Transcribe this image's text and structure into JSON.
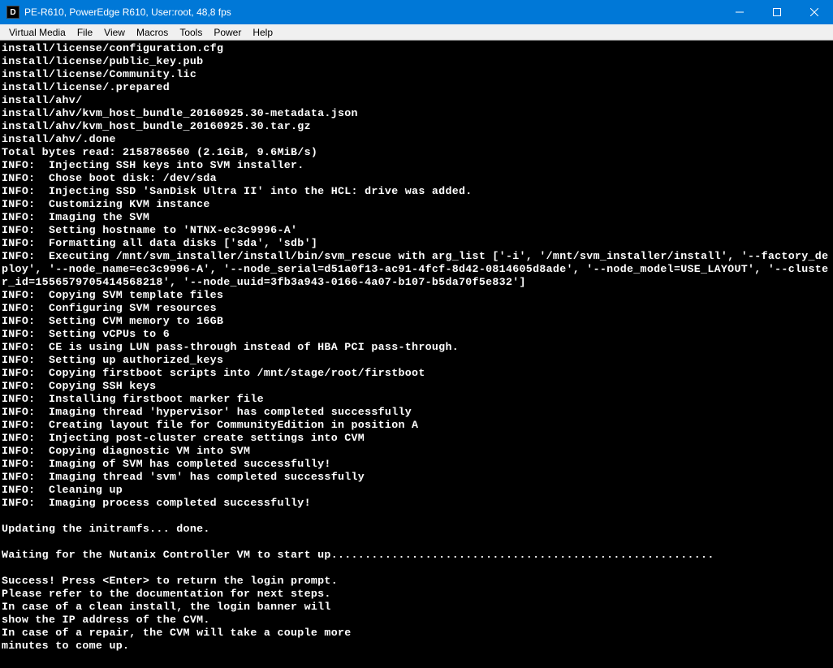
{
  "titlebar": {
    "icon_letter": "D",
    "title": "PE-R610, PowerEdge R610, User:root, 48,8 fps"
  },
  "menu": {
    "items": [
      "Virtual Media",
      "File",
      "View",
      "Macros",
      "Tools",
      "Power",
      "Help"
    ]
  },
  "terminal": {
    "lines": [
      "install/license/configuration.cfg",
      "install/license/public_key.pub",
      "install/license/Community.lic",
      "install/license/.prepared",
      "install/ahv/",
      "install/ahv/kvm_host_bundle_20160925.30-metadata.json",
      "install/ahv/kvm_host_bundle_20160925.30.tar.gz",
      "install/ahv/.done",
      "Total bytes read: 2158786560 (2.1GiB, 9.6MiB/s)",
      "INFO:  Injecting SSH keys into SVM installer.",
      "INFO:  Chose boot disk: /dev/sda",
      "INFO:  Injecting SSD 'SanDisk Ultra II' into the HCL: drive was added.",
      "INFO:  Customizing KVM instance",
      "INFO:  Imaging the SVM",
      "INFO:  Setting hostname to 'NTNX-ec3c9996-A'",
      "INFO:  Formatting all data disks ['sda', 'sdb']",
      "INFO:  Executing /mnt/svm_installer/install/bin/svm_rescue with arg_list ['-i', '/mnt/svm_installer/install', '--factory_deploy', '--node_name=ec3c9996-A', '--node_serial=d51a0f13-ac91-4fcf-8d42-0814605d8ade', '--node_model=USE_LAYOUT', '--cluster_id=1556579705414568218', '--node_uuid=3fb3a943-0166-4a07-b107-b5da70f5e832']",
      "INFO:  Copying SVM template files",
      "INFO:  Configuring SVM resources",
      "INFO:  Setting CVM memory to 16GB",
      "INFO:  Setting vCPUs to 6",
      "INFO:  CE is using LUN pass-through instead of HBA PCI pass-through.",
      "INFO:  Setting up authorized_keys",
      "INFO:  Copying firstboot scripts into /mnt/stage/root/firstboot",
      "INFO:  Copying SSH keys",
      "INFO:  Installing firstboot marker file",
      "INFO:  Imaging thread 'hypervisor' has completed successfully",
      "INFO:  Creating layout file for CommunityEdition in position A",
      "INFO:  Injecting post-cluster create settings into CVM",
      "INFO:  Copying diagnostic VM into SVM",
      "INFO:  Imaging of SVM has completed successfully!",
      "INFO:  Imaging thread 'svm' has completed successfully",
      "INFO:  Cleaning up",
      "INFO:  Imaging process completed successfully!",
      "",
      "Updating the initramfs... done.",
      "",
      "Waiting for the Nutanix Controller VM to start up.........................................................",
      "",
      "Success! Press <Enter> to return the login prompt.",
      "Please refer to the documentation for next steps.",
      "In case of a clean install, the login banner will",
      "show the IP address of the CVM.",
      "In case of a repair, the CVM will take a couple more",
      "minutes to come up."
    ]
  }
}
